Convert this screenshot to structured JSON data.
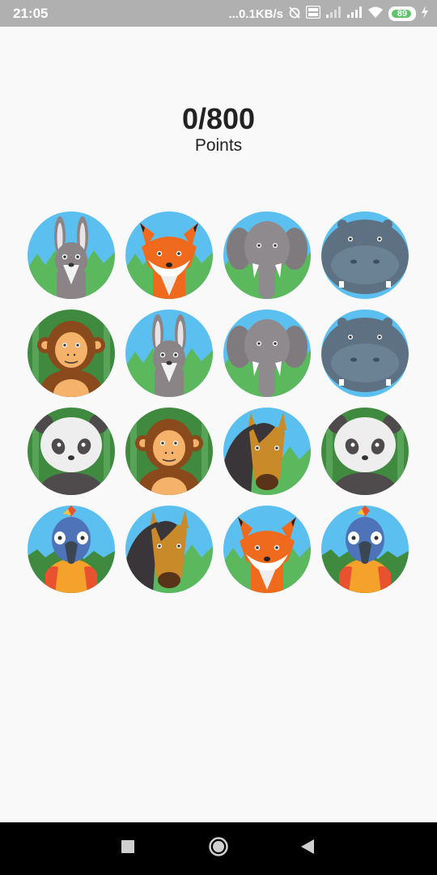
{
  "status_bar": {
    "time": "21:05",
    "network_speed": "...0.1KB/s",
    "battery_level": "89",
    "icons": [
      "alarm-off-icon",
      "volte-icon",
      "signal-icon",
      "signal-icon",
      "wifi-icon",
      "battery-icon",
      "charging-icon"
    ]
  },
  "game": {
    "score": "0/800",
    "score_label": "Points",
    "cards": [
      {
        "animal": "rabbit"
      },
      {
        "animal": "fox"
      },
      {
        "animal": "elephant"
      },
      {
        "animal": "hippo"
      },
      {
        "animal": "monkey"
      },
      {
        "animal": "rabbit"
      },
      {
        "animal": "elephant"
      },
      {
        "animal": "hippo"
      },
      {
        "animal": "panda"
      },
      {
        "animal": "monkey"
      },
      {
        "animal": "horse"
      },
      {
        "animal": "panda"
      },
      {
        "animal": "parrot"
      },
      {
        "animal": "horse"
      },
      {
        "animal": "fox"
      },
      {
        "animal": "parrot"
      }
    ]
  },
  "nav_bar": {
    "buttons": [
      "recents-square-icon",
      "home-circle-icon",
      "back-triangle-icon"
    ]
  },
  "colors": {
    "sky": "#5bc0f0",
    "grass": "#5cb85c",
    "background": "#f9f9f9",
    "status_bar": "#b0b0b0"
  }
}
